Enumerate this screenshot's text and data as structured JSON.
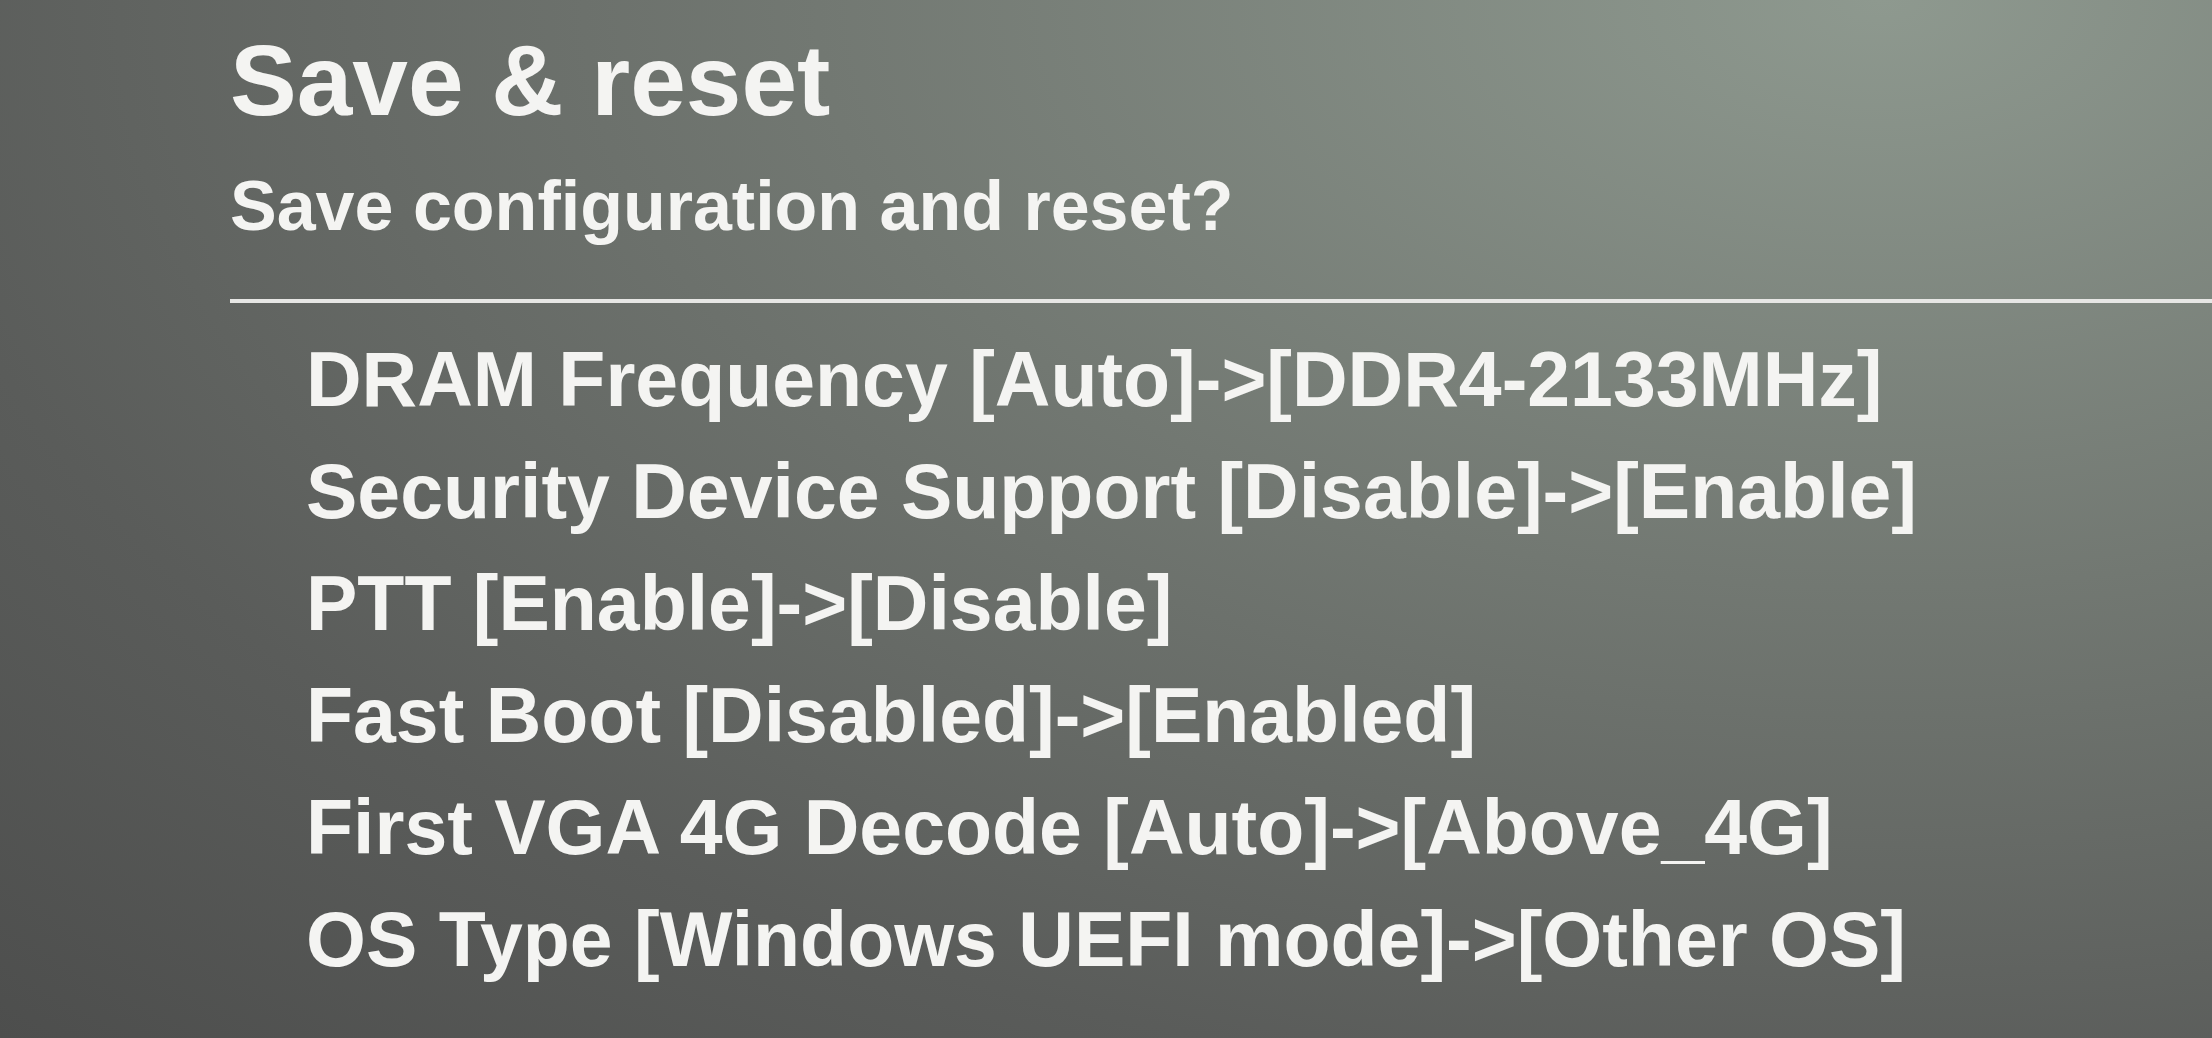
{
  "dialog": {
    "title": "Save & reset",
    "prompt": "Save configuration and reset?",
    "changes": [
      "DRAM Frequency [Auto]->[DDR4-2133MHz]",
      "Security Device Support [Disable]->[Enable]",
      "PTT [Enable]->[Disable]",
      "Fast Boot [Disabled]->[Enabled]",
      "First VGA 4G Decode [Auto]->[Above_4G]",
      "OS Type [Windows UEFI mode]->[Other OS]"
    ]
  }
}
